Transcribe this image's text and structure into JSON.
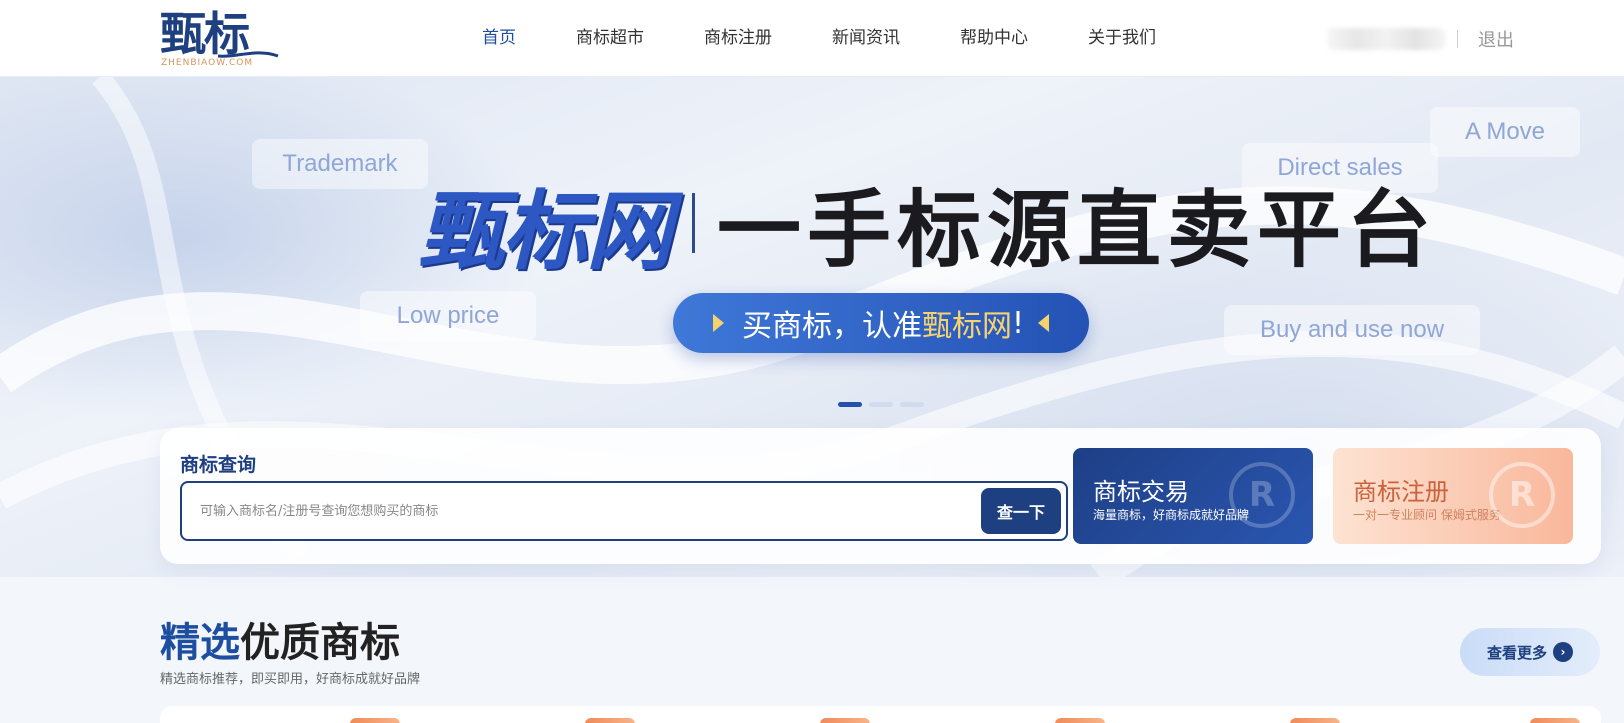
{
  "header": {
    "logo_text": "甄标",
    "logo_sub": "ZHENBIAOW.COM",
    "nav": [
      {
        "label": "首页",
        "active": true
      },
      {
        "label": "商标超市",
        "active": false
      },
      {
        "label": "商标注册",
        "active": false
      },
      {
        "label": "新闻资讯",
        "active": false
      },
      {
        "label": "帮助中心",
        "active": false
      },
      {
        "label": "关于我们",
        "active": false
      }
    ],
    "logout": "退出"
  },
  "banner": {
    "tags": [
      "Trademark",
      "A Move",
      "Direct sales",
      "Low price",
      "Buy and use now"
    ],
    "brand": "甄标网",
    "slogan": "一手标源直卖平台",
    "pill_prefix": "买商标，认准",
    "pill_highlight": "甄标网",
    "pill_suffix": "!",
    "slide_count": 3,
    "active_slide": 1
  },
  "search": {
    "title": "商标查询",
    "placeholder": "可输入商标名/注册号查询您想购买的商标",
    "button": "查一下"
  },
  "cards": {
    "trade": {
      "title": "商标交易",
      "subtitle": "海量商标，好商标成就好品牌"
    },
    "register": {
      "title": "商标注册",
      "subtitle": "一对一专业顾问 保姆式服务"
    }
  },
  "section": {
    "title_a": "精选",
    "title_b": "优质商标",
    "subtitle": "精选商标推荐，即买即用，好商标成就好品牌",
    "more": "查看更多"
  },
  "colors": {
    "brand_blue": "#1e3f80",
    "accent_blue": "#2d58c4",
    "accent_orange": "#f08a58",
    "highlight_gold": "#f7d36e"
  }
}
